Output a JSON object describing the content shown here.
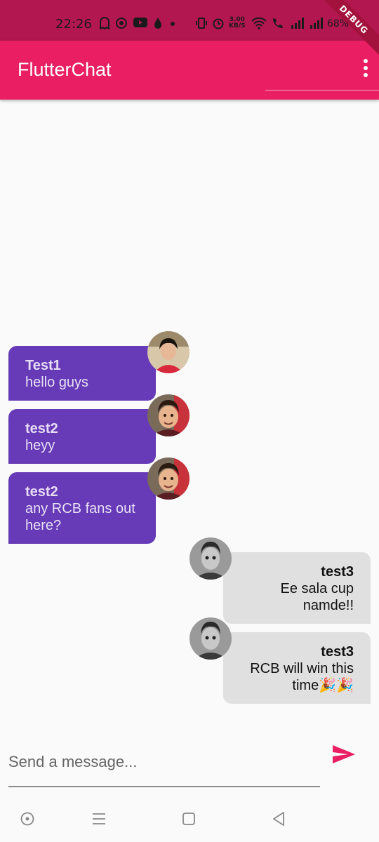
{
  "status_bar": {
    "time": "22:26",
    "speed_value": "3.00",
    "speed_unit": "KB/S",
    "battery": "68%"
  },
  "debug_label": "DEBUG",
  "app_bar": {
    "title": "FlutterChat",
    "accent_color": "#e91e63"
  },
  "messages": [
    {
      "sender": "Test1",
      "text": "hello guys",
      "side": "left"
    },
    {
      "sender": "test2",
      "text": "heyy",
      "side": "left"
    },
    {
      "sender": "test2",
      "text": "any RCB fans out here?",
      "side": "left"
    },
    {
      "sender": "test3",
      "text": "Ee sala cup namde!!",
      "side": "right"
    },
    {
      "sender": "test3",
      "text": "RCB will win this time🎉🎉",
      "side": "right"
    }
  ],
  "composer": {
    "placeholder": "Send a message...",
    "send_icon": "send-icon"
  },
  "colors": {
    "incoming_bubble": "#673ab7",
    "outgoing_bubble": "#e0e0e0"
  }
}
